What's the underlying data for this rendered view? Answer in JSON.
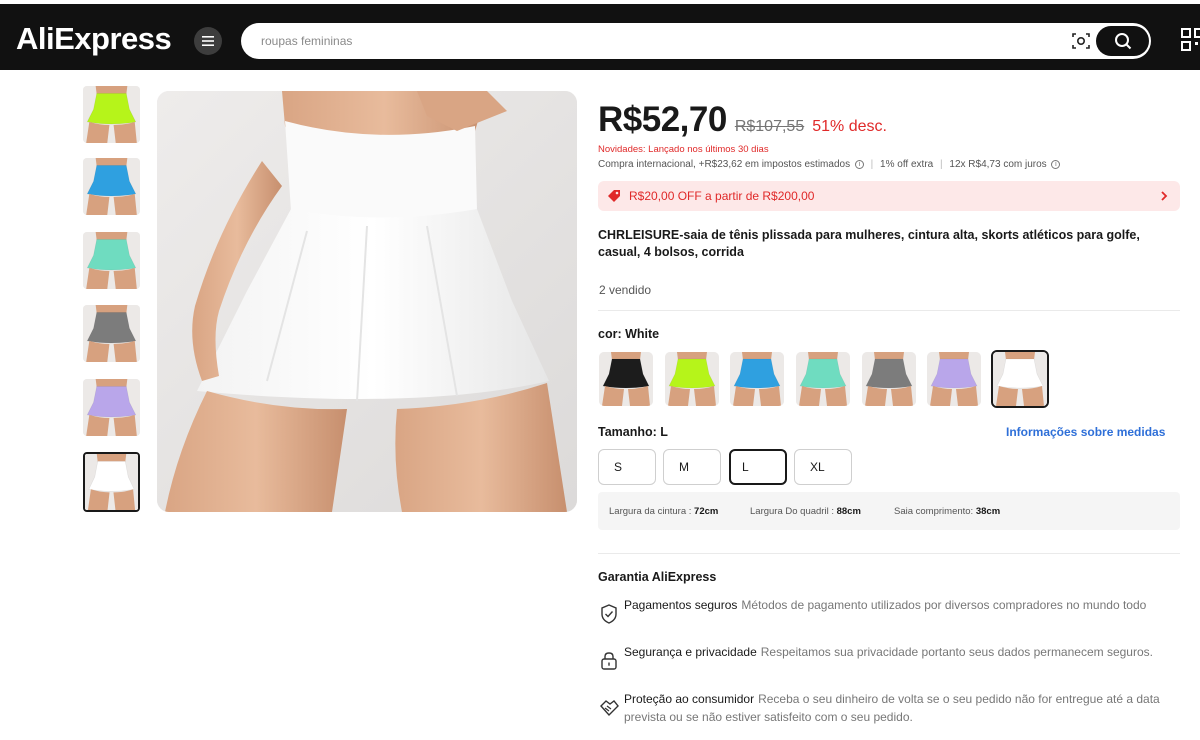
{
  "header": {
    "logo": "AliExpress",
    "search_placeholder": "roupas femininas"
  },
  "product": {
    "price": "R$52,70",
    "old_price": "R$107,55",
    "discount": "51% desc.",
    "novidade": "Novidades: Lançado nos últimos 30 dias",
    "tax_text": "Compra internacional, +R$23,62 em impostos estimados",
    "extra_off": "1% off extra",
    "installments": "12x R$4,73 com juros",
    "coupon": "R$20,00 OFF a partir de R$200,00",
    "title": "CHRLEISURE-saia de tênis plissada para mulheres, cintura alta, skorts atléticos para golfe, casual, 4 bolsos, corrida",
    "sold": "2 vendido",
    "color_label": "cor: White",
    "size_label": "Tamanho: L",
    "size_guide": "Informações sobre medidas",
    "sizes": [
      "S",
      "M",
      "L",
      "XL"
    ],
    "selected_size": "L",
    "swatch_colors": [
      "#1c1c1c",
      "#b6f41a",
      "#2fa0e0",
      "#6fdcc0",
      "#7c7c7c",
      "#b9a6ea",
      "#ffffff"
    ],
    "thumb_colors": [
      "#b6f41a",
      "#2fa0e0",
      "#6fdcc0",
      "#7c7c7c",
      "#b9a6ea",
      "#ffffff"
    ],
    "measures": {
      "waist_label": "Largura da cintura :",
      "waist_value": "72cm",
      "hip_label": "Largura Do quadril :",
      "hip_value": "88cm",
      "length_label": "Saia comprimento:",
      "length_value": "38cm"
    }
  },
  "guarantee": {
    "title": "Garantia AliExpress",
    "items": [
      {
        "title": "Pagamentos seguros",
        "text": "Métodos de pagamento utilizados por diversos compradores no mundo todo",
        "icon": "shield-check-icon"
      },
      {
        "title": "Segurança e privacidade",
        "text": "Respeitamos sua privacidade portanto seus dados permanecem seguros.",
        "icon": "lock-icon"
      },
      {
        "title": "Proteção ao consumidor",
        "text": "Receba o seu dinheiro de volta se o seu pedido não for entregue até a data prevista ou se não estiver satisfeito com o seu pedido.",
        "icon": "handshake-icon"
      }
    ]
  },
  "colors": {
    "brand_red": "#e02929",
    "link_blue": "#2e6fd8",
    "header_bg": "#111111"
  }
}
